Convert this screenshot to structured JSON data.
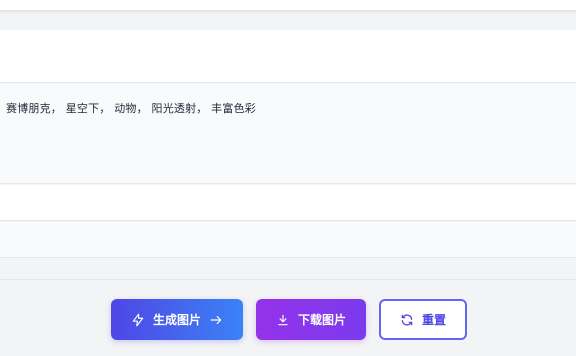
{
  "prompt": {
    "text": "赛博朋克， 星空下， 动物， 阳光透射， 丰富色彩"
  },
  "actions": {
    "generate_label": "生成图片",
    "download_label": "下载图片",
    "reset_label": "重置"
  },
  "icons": {
    "generate_leading": "lightning-icon",
    "generate_trailing": "arrow-right-icon",
    "download": "download-icon",
    "reset": "refresh-icon"
  },
  "colors": {
    "generate_gradient": [
      "#4f46e5",
      "#3b82f6"
    ],
    "download_gradient": [
      "#9333ea",
      "#7c3aed"
    ],
    "reset_border": "#6366f1",
    "reset_text": "#4f46e5"
  }
}
